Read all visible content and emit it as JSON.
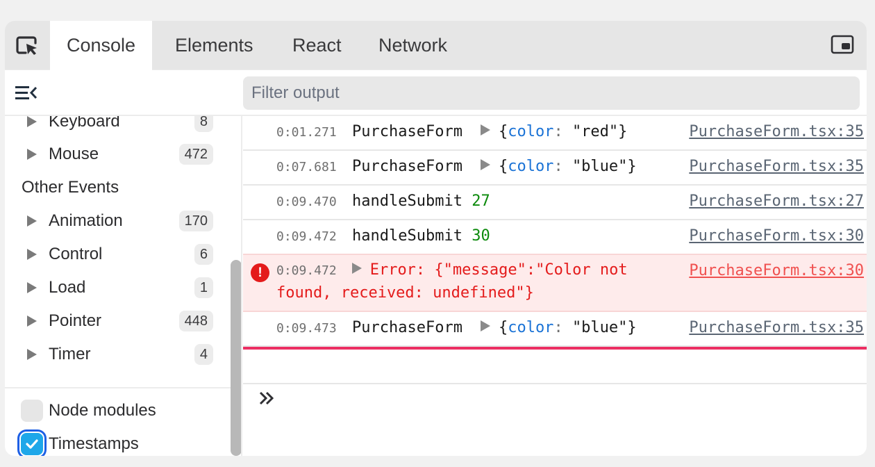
{
  "tabs": [
    {
      "label": "Console",
      "active": true
    },
    {
      "label": "Elements",
      "active": false
    },
    {
      "label": "React",
      "active": false
    },
    {
      "label": "Network",
      "active": false
    }
  ],
  "icons": {
    "picker": "element-picker-icon",
    "pip": "picture-in-picture-icon",
    "sidebar_toggle": "collapse-sidebar-icon",
    "prompt": "double-chevron-right-icon",
    "error": "error-circle-icon"
  },
  "filter": {
    "placeholder": "Filter output",
    "value": ""
  },
  "sidebar": {
    "items_top": [
      {
        "label": "Keyboard",
        "count": "8"
      },
      {
        "label": "Mouse",
        "count": "472"
      }
    ],
    "heading": "Other Events",
    "items_other": [
      {
        "label": "Animation",
        "count": "170"
      },
      {
        "label": "Control",
        "count": "6"
      },
      {
        "label": "Load",
        "count": "1"
      },
      {
        "label": "Pointer",
        "count": "448"
      },
      {
        "label": "Timer",
        "count": "4"
      }
    ],
    "options": [
      {
        "label": "Node modules",
        "checked": false
      },
      {
        "label": "Timestamps",
        "checked": true
      }
    ]
  },
  "logs": [
    {
      "timestamp": "0:01.271",
      "name": "PurchaseForm",
      "obj_key": "color",
      "obj_value": "\"red\"",
      "source": "PurchaseForm.tsx:35"
    },
    {
      "timestamp": "0:07.681",
      "name": "PurchaseForm",
      "obj_key": "color",
      "obj_value": "\"blue\"",
      "source": "PurchaseForm.tsx:35"
    },
    {
      "timestamp": "0:09.470",
      "name": "handleSubmit",
      "value": "27",
      "source": "PurchaseForm.tsx:27"
    },
    {
      "timestamp": "0:09.472",
      "name": "handleSubmit",
      "value": "30",
      "source": "PurchaseForm.tsx:30"
    },
    {
      "timestamp": "0:09.472",
      "error": "Error: {\"message\":\"Color not found, received: undefined\"}",
      "source": "PurchaseForm.tsx:30"
    },
    {
      "timestamp": "0:09.473",
      "name": "PurchaseForm",
      "obj_key": "color",
      "obj_value": "\"blue\"",
      "source": "PurchaseForm.tsx:35"
    }
  ],
  "colors": {
    "error_text": "#e41b1b",
    "error_bg": "#feebeb",
    "number": "#0c8a0c",
    "object_key": "#1b73d6",
    "marker": "#ec2e63",
    "checkbox_checked": "#1ea7e9"
  }
}
